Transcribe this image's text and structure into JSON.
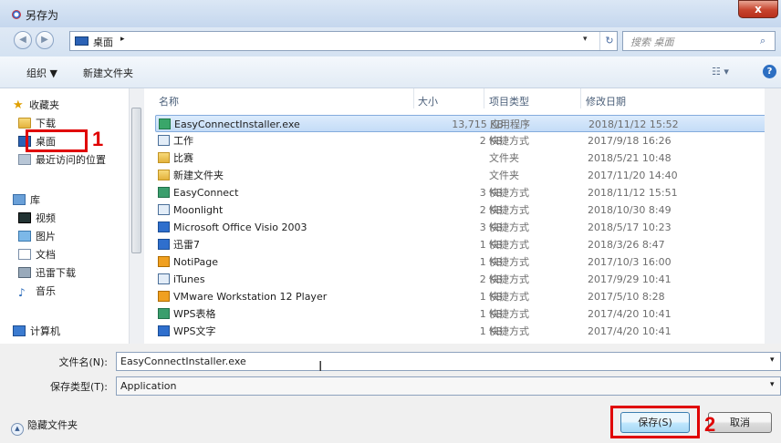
{
  "window": {
    "title": "另存为",
    "close_label": "x"
  },
  "address": {
    "back_icon": "back-arrow-icon",
    "forward_icon": "forward-arrow-icon",
    "path": "桌面",
    "path_arrow": "▸",
    "dropdown": "▾",
    "refresh_glyph": "↻",
    "search_placeholder": "搜索 桌面",
    "search_glyph": "⌕"
  },
  "toolbar": {
    "organize": "组织 ▼",
    "new_folder": "新建文件夹",
    "view_glyph": "☷ ▾",
    "help_glyph": "?"
  },
  "nav": {
    "favorites": "收藏夹",
    "downloads": "下载",
    "desktop": "桌面",
    "recent": "最近访问的位置",
    "library": "库",
    "video": "视频",
    "pictures": "图片",
    "documents": "文档",
    "xunlei_dl": "迅雷下载",
    "music": "音乐",
    "computer": "计算机"
  },
  "columns": {
    "name": "名称",
    "size": "大小",
    "type": "项目类型",
    "date": "修改日期"
  },
  "files": [
    {
      "name": "EasyConnectInstaller.exe",
      "size": "13,715 KB",
      "type": "应用程序",
      "date": "2018/11/12 15:52",
      "icon": "exe"
    },
    {
      "name": "工作",
      "size": "2 KB",
      "type": "快捷方式",
      "date": "2017/9/18 16:26",
      "icon": "shortcut"
    },
    {
      "name": "比赛",
      "size": "",
      "type": "文件夹",
      "date": "2018/5/21 10:48",
      "icon": "folder"
    },
    {
      "name": "新建文件夹",
      "size": "",
      "type": "文件夹",
      "date": "2017/11/20 14:40",
      "icon": "folder"
    },
    {
      "name": "EasyConnect",
      "size": "3 KB",
      "type": "快捷方式",
      "date": "2018/11/12 15:51",
      "icon": "green"
    },
    {
      "name": "Moonlight",
      "size": "2 KB",
      "type": "快捷方式",
      "date": "2018/10/30 8:49",
      "icon": "shortcut"
    },
    {
      "name": "Microsoft Office Visio 2003",
      "size": "3 KB",
      "type": "快捷方式",
      "date": "2018/5/17 10:23",
      "icon": "blue"
    },
    {
      "name": "迅雷7",
      "size": "1 KB",
      "type": "快捷方式",
      "date": "2018/3/26 8:47",
      "icon": "blue"
    },
    {
      "name": "NotiPage",
      "size": "1 KB",
      "type": "快捷方式",
      "date": "2017/10/3 16:00",
      "icon": "orange"
    },
    {
      "name": "iTunes",
      "size": "2 KB",
      "type": "快捷方式",
      "date": "2017/9/29 10:41",
      "icon": "shortcut"
    },
    {
      "name": "VMware Workstation 12 Player",
      "size": "1 KB",
      "type": "快捷方式",
      "date": "2017/5/10 8:28",
      "icon": "orange"
    },
    {
      "name": "WPS表格",
      "size": "1 KB",
      "type": "快捷方式",
      "date": "2017/4/20 10:41",
      "icon": "green"
    },
    {
      "name": "WPS文字",
      "size": "1 KB",
      "type": "快捷方式",
      "date": "2017/4/20 10:41",
      "icon": "blue"
    }
  ],
  "form": {
    "filename_label": "文件名(N):",
    "filename_value": "EasyConnectInstaller.exe",
    "filetype_label": "保存类型(T):",
    "filetype_value": "Application",
    "hide_folders": "隐藏文件夹",
    "save": "保存(S)",
    "cancel": "取消",
    "dropdown_glyph": "▾",
    "caret_glyph": "▲",
    "ibeam_glyph": "I"
  },
  "annotations": {
    "step1": "1",
    "step2": "2",
    "color": "#e00000"
  }
}
